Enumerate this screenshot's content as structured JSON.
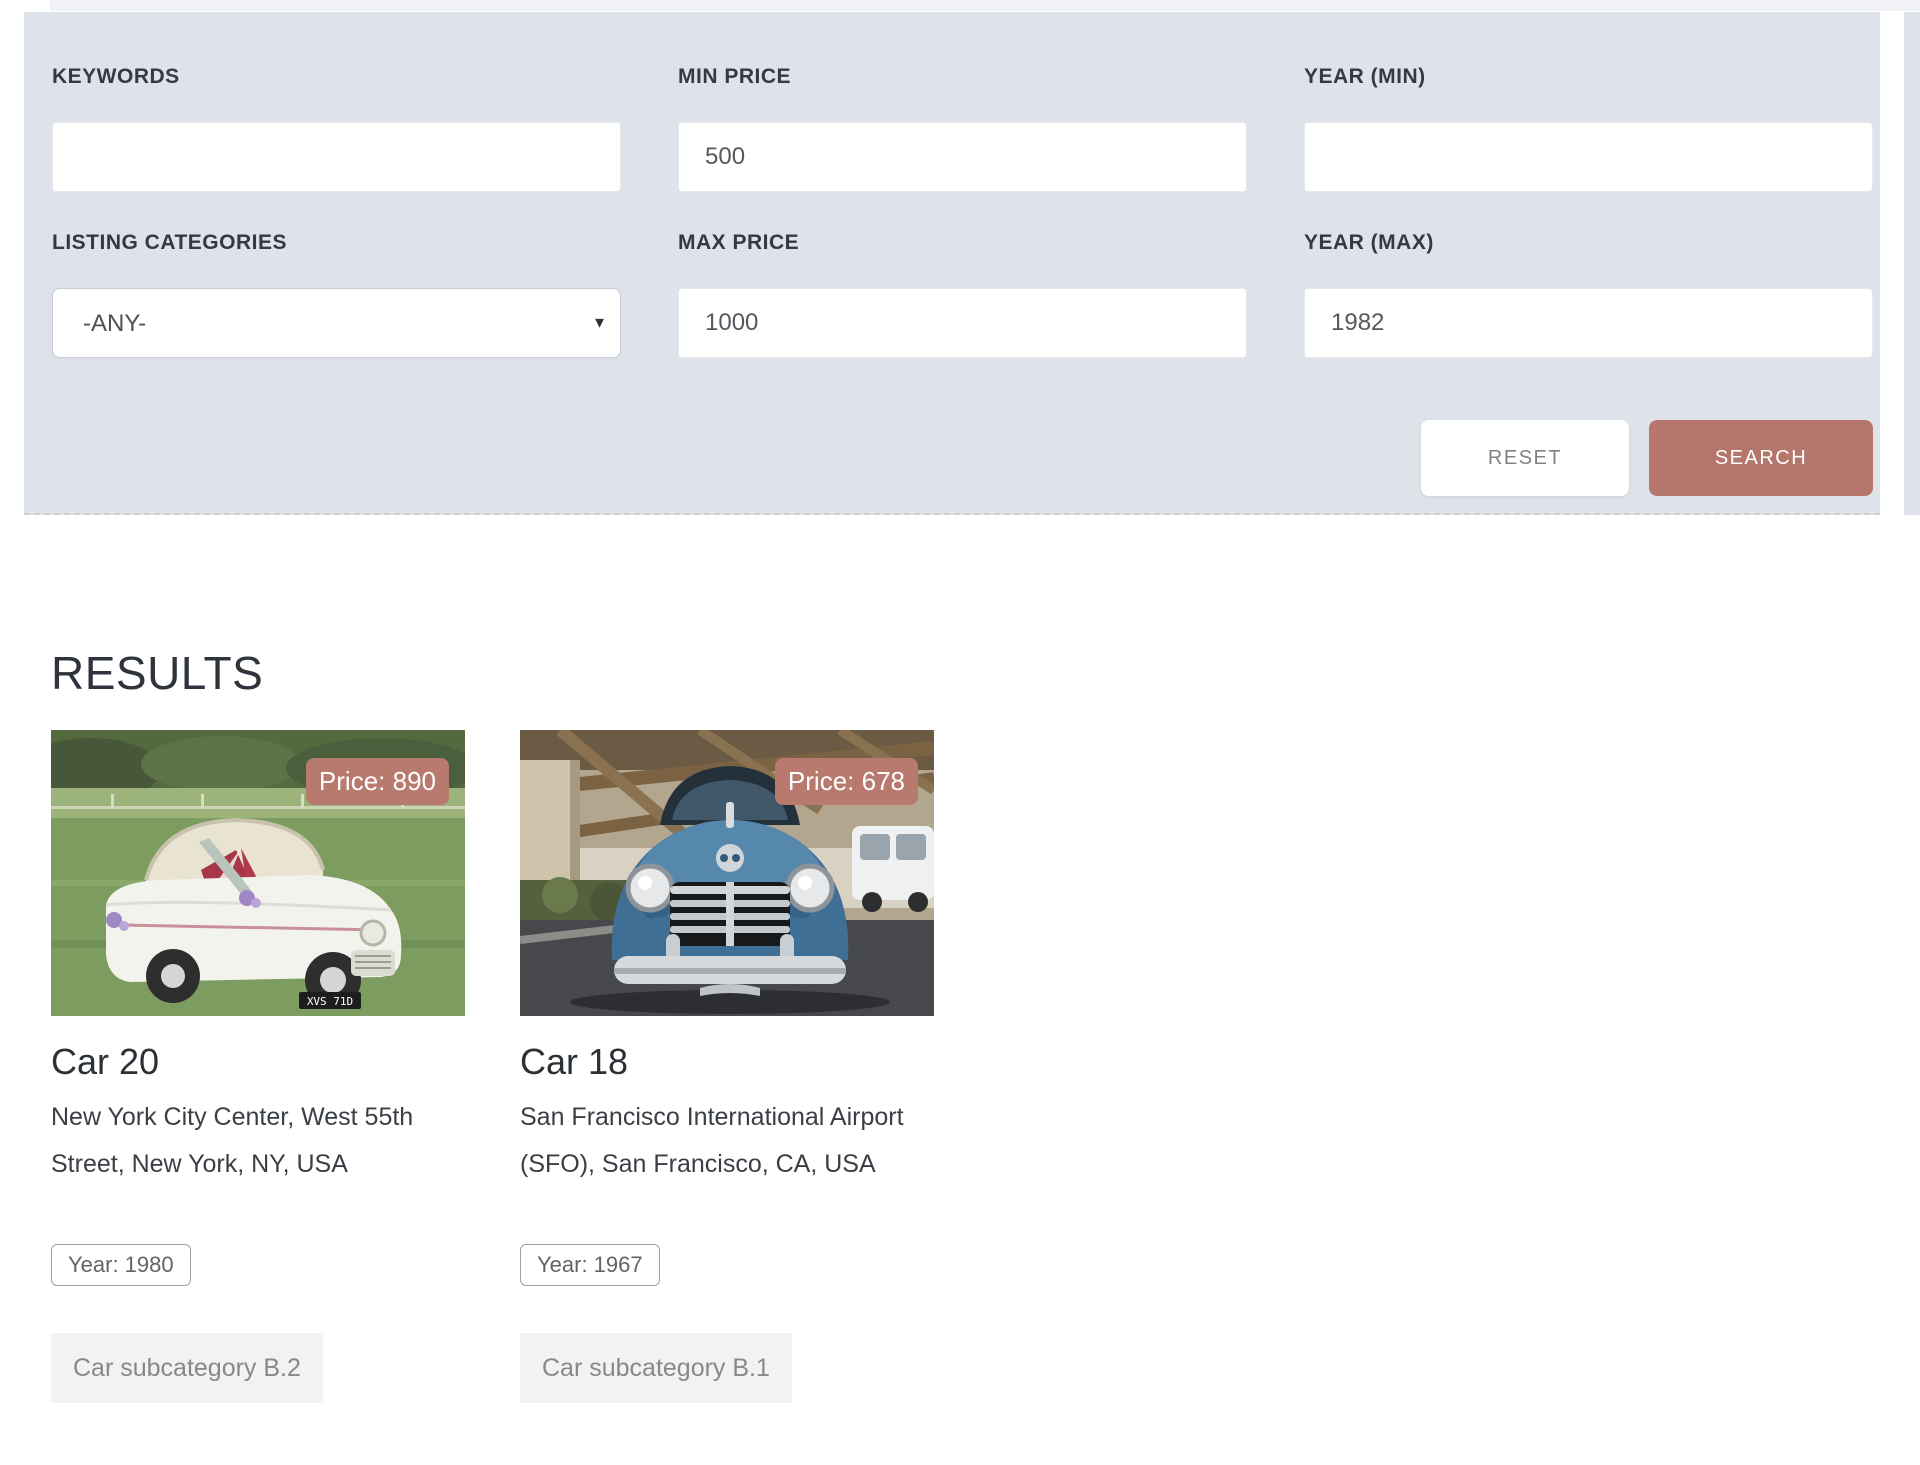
{
  "accent_color": "#b5766c",
  "panel_color": "#dee3ea",
  "filter": {
    "fields": [
      {
        "label": "KEYWORDS",
        "value": ""
      },
      {
        "label": "MIN PRICE",
        "value": "500"
      },
      {
        "label": "YEAR (MIN)",
        "value": ""
      },
      {
        "label": "LISTING CATEGORIES",
        "value": "-ANY-"
      },
      {
        "label": "MAX PRICE",
        "value": "1000"
      },
      {
        "label": "YEAR (MAX)",
        "value": "1982"
      }
    ],
    "buttons": {
      "reset": "RESET",
      "search": "SEARCH"
    }
  },
  "results": {
    "heading": "RESULTS",
    "cards": [
      {
        "title": "Car 20",
        "price_badge": "Price: 890",
        "location": "New York City Center, West 55th Street, New York, NY, USA",
        "year_badge": "Year: 1980",
        "category_tag": "Car subcategory B.2",
        "license_plate": "XVS 71D"
      },
      {
        "title": "Car 18",
        "price_badge": "Price: 678",
        "location": "San Francisco International Airport (SFO), San Francisco, CA, USA",
        "year_badge": "Year: 1967",
        "category_tag": "Car subcategory B.1"
      }
    ]
  }
}
